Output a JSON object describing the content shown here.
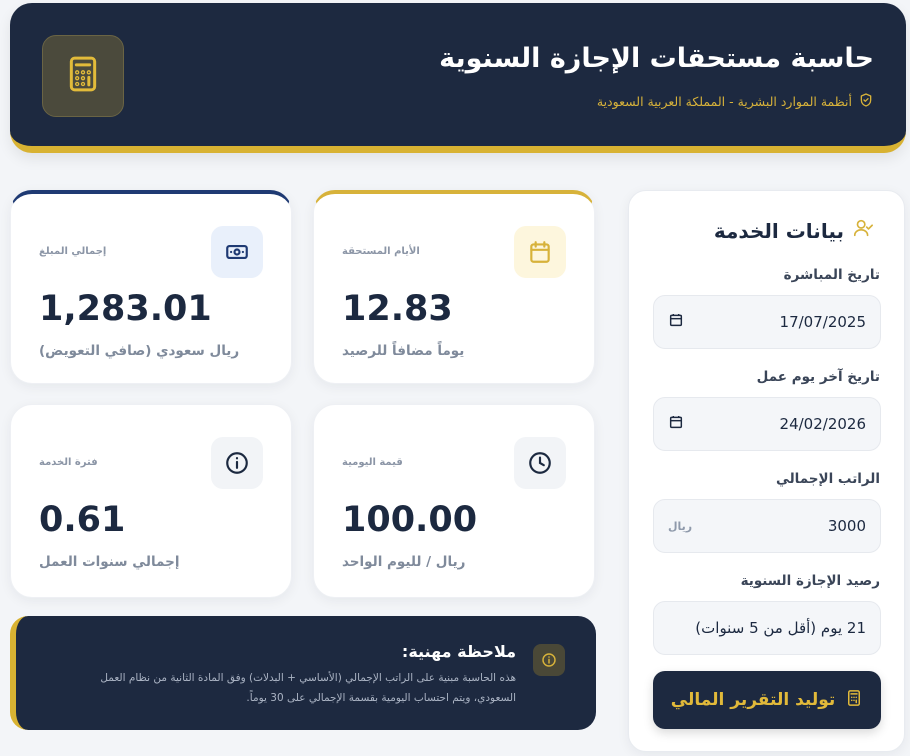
{
  "header": {
    "title": "حاسبة مستحقات الإجازة السنوية",
    "subtitle": "أنظمة الموارد البشرية - المملكة العربية السعودية",
    "logo_icon": "calculator-icon",
    "shield_icon": "shield-check-icon"
  },
  "form": {
    "title": "بيانات الخدمة",
    "title_icon": "user-check-icon",
    "start_date": {
      "label": "تاريخ المباشرة",
      "value": "17/07/2025"
    },
    "end_date": {
      "label": "تاريخ آخر يوم عمل",
      "value": "24/02/2026"
    },
    "salary": {
      "label": "الراتب الإجمالي",
      "value": "3000",
      "unit": "ريال"
    },
    "balance": {
      "label": "رصيد الإجازة السنوية",
      "value": "21 يوم (أقل من 5 سنوات)"
    },
    "submit_label": "توليد التقرير المالي"
  },
  "cards": {
    "days": {
      "label": "الأيام المستحقة",
      "value": "12.83",
      "unit": "يوماً مضافاً للرصيد",
      "icon": "calendar-icon"
    },
    "total": {
      "label": "إجمالي المبلغ",
      "value": "1,283.01",
      "unit": "ريال سعودي (صافي التعويض)",
      "icon": "banknote-icon"
    },
    "daily": {
      "label": "قيمة اليومية",
      "value": "100.00",
      "unit": "ريال / لليوم الواحد",
      "icon": "clock-icon"
    },
    "service": {
      "label": "فترة الخدمة",
      "value": "0.61",
      "unit": "إجمالي سنوات العمل",
      "icon": "info-icon"
    }
  },
  "note": {
    "title": "ملاحظة مهنية:",
    "body": "هذه الحاسبة مبنية على الراتب الإجمالي (الأساسي + البدلات) وفق المادة الثانية من نظام العمل السعودي، ويتم احتساب اليومية بقسمة الإجمالي على 30 يوماً.",
    "icon": "info-icon"
  },
  "colors": {
    "navy": "#1d2940",
    "gold": "#d8b232",
    "background": "#f3f5f8"
  }
}
